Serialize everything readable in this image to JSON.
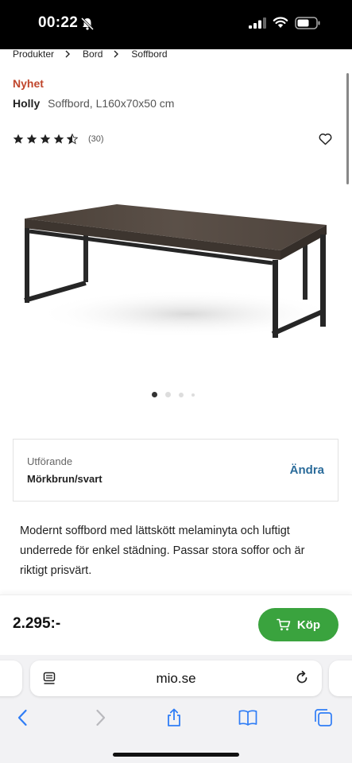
{
  "status_bar": {
    "time": "00:22",
    "icons": [
      "bell-slash-icon",
      "signal-icon",
      "wifi-icon",
      "battery-icon"
    ]
  },
  "breadcrumb": [
    "Produkter",
    "Bord",
    "Soffbord"
  ],
  "product": {
    "badge": "Nyhet",
    "brand": "Holly",
    "description_short": "Soffbord, L160x70x50 cm",
    "rating_stars": 4.5,
    "review_count": "(30)",
    "image_count": 4,
    "active_image": 1
  },
  "variant": {
    "label": "Utförande",
    "value": "Mörkbrun/svart",
    "change_label": "Ändra"
  },
  "description": "Modernt soffbord med lättskött melaminyta och luftigt underrede för enkel städning. Passar stora soffor och är riktigt prisvärt.",
  "purchase": {
    "price": "2.295:-",
    "buy_label": "Köp"
  },
  "browser": {
    "url": "mio.se",
    "toolbar_icons": [
      "back-icon",
      "forward-icon",
      "share-icon",
      "bookmarks-icon",
      "tabs-icon"
    ]
  },
  "colors": {
    "badge": "#c0462c",
    "link": "#2a6b9a",
    "buy_button": "#3aa33e"
  }
}
